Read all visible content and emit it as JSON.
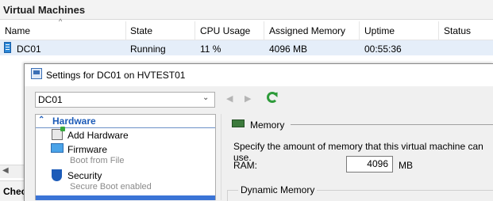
{
  "manager": {
    "title": "Virtual Machines",
    "columns": [
      "Name",
      "State",
      "CPU Usage",
      "Assigned Memory",
      "Uptime",
      "Status"
    ],
    "vm_row": {
      "name": "DC01",
      "state": "Running",
      "cpu": "11 %",
      "memory": "4096 MB",
      "uptime": "00:55:36",
      "status": ""
    },
    "lower_label": "Chec"
  },
  "dialog": {
    "title": "Settings for DC01 on HVTEST01",
    "vm_select": "DC01",
    "tree": {
      "section": "Hardware",
      "items": [
        {
          "label": "Add Hardware",
          "sub": ""
        },
        {
          "label": "Firmware",
          "sub": "Boot from File"
        },
        {
          "label": "Security",
          "sub": "Secure Boot enabled"
        }
      ]
    },
    "memory": {
      "heading": "Memory",
      "description": "Specify the amount of memory that this virtual machine can use.",
      "ram_label": "RAM:",
      "ram_value": "4096",
      "ram_unit": "MB",
      "dynamic_label": "Dynamic Memory"
    }
  },
  "icons": [
    "sort-up-icon",
    "vm-icon",
    "settings-icon",
    "dropdown-arrow-icon",
    "back-icon",
    "forward-icon",
    "refresh-icon",
    "collapse-icon",
    "add-hardware-icon",
    "firmware-icon",
    "security-icon",
    "memory-icon"
  ],
  "colors": {
    "accent": "#1c5bb8",
    "selection": "#e5eef9",
    "refresh": "#2e9b3a"
  }
}
